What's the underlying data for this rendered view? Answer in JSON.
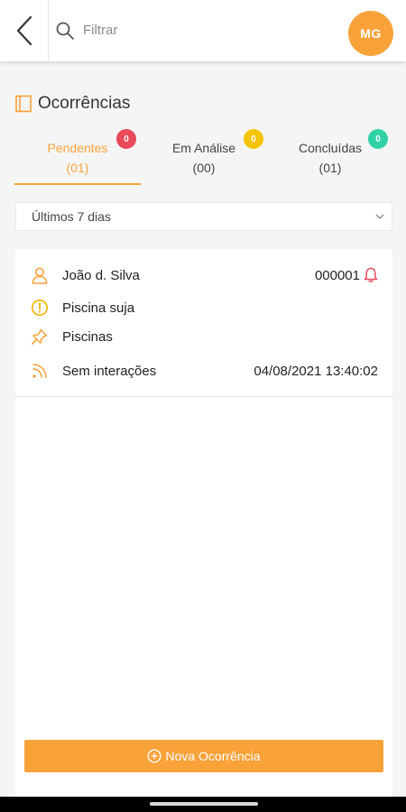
{
  "header": {
    "search_placeholder": "Filtrar",
    "avatar_initials": "MG"
  },
  "page": {
    "title": "Ocorrências"
  },
  "tabs": [
    {
      "label": "Pendentes",
      "count": "(01)",
      "badge": "0",
      "badge_color": "#ea4a5a",
      "active": true
    },
    {
      "label": "Em Análise",
      "count": "(00)",
      "badge": "0",
      "badge_color": "#f5c400",
      "active": false
    },
    {
      "label": "Concluídas",
      "count": "(01)",
      "badge": "0",
      "badge_color": "#2fd3a6",
      "active": false
    }
  ],
  "filter": {
    "selected": "Últimos 7 dias"
  },
  "occurrences": [
    {
      "name": "João d. Silva",
      "number": "000001",
      "description": "Piscina suja",
      "category": "Piscinas",
      "status": "Sem interações",
      "datetime": "04/08/2021 13:40:02"
    }
  ],
  "actions": {
    "new_label": "Nova Ocorrência"
  },
  "colors": {
    "accent": "#f9a23a",
    "alert": "#ea4a5a"
  },
  "icons": {
    "back": "chevron-left-icon",
    "search": "search-icon",
    "title": "book-icon",
    "filter_dropdown": "chevron-down-icon",
    "user": "user-icon",
    "notification": "bell-icon",
    "description": "alert-circle-icon",
    "category": "pin-icon",
    "status": "rss-icon",
    "add": "plus-circle-icon"
  }
}
